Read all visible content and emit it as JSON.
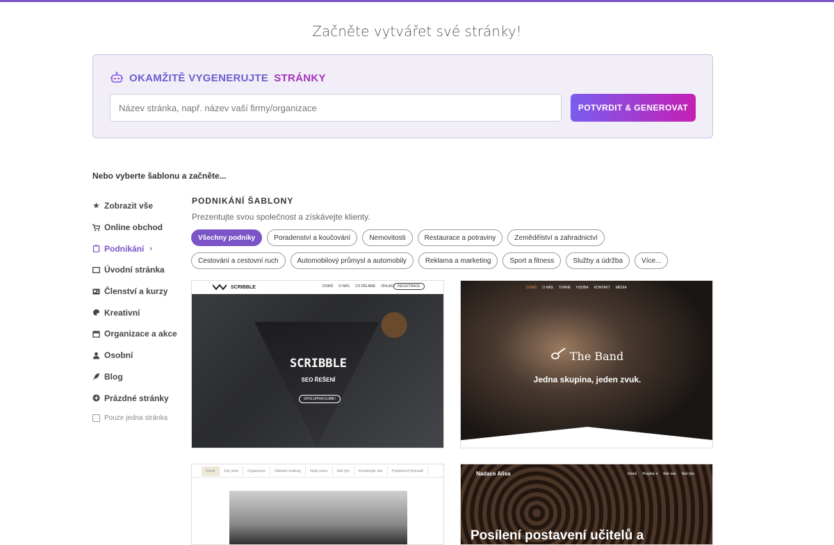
{
  "page": {
    "title": "Začněte vytvářet své stránky!"
  },
  "generator": {
    "icon": "robot-icon",
    "heading_part1": "OKAMŽITĚ VYGENERUJTE",
    "heading_part2": "STRÁNKY",
    "input_placeholder": "Název stránka, např. název vaší firmy/organizace",
    "input_value": "",
    "button_label": "POTVRDIT & GENEROVAT"
  },
  "or_choose": "Nebo vyberte šablonu a začněte...",
  "sidebar": {
    "items": [
      {
        "label": "Zobrazit vše",
        "icon": "star-icon"
      },
      {
        "label": "Online obchod",
        "icon": "cart-icon"
      },
      {
        "label": "Podnikání",
        "icon": "clipboard-icon",
        "active": true
      },
      {
        "label": "Úvodní stránka",
        "icon": "window-icon"
      },
      {
        "label": "Členství a kurzy",
        "icon": "id-card-icon"
      },
      {
        "label": "Kreativní",
        "icon": "palette-icon"
      },
      {
        "label": "Organizace a akce",
        "icon": "calendar-icon"
      },
      {
        "label": "Osobní",
        "icon": "user-icon"
      },
      {
        "label": "Blog",
        "icon": "feather-icon"
      },
      {
        "label": "Prázdné stránky",
        "icon": "plus-circle-icon"
      }
    ],
    "single_page_label": "Pouze jedna stránka"
  },
  "section": {
    "title": "PODNIKÁNÍ ŠABLONY",
    "subtitle": "Prezentujte svou společnost a získávejte klienty."
  },
  "filters": {
    "row1": [
      "Všechny podniky",
      "Poradenství a koučování",
      "Nemovitosti",
      "Restaurace a potraviny",
      "Zemědělství a zahradnictví"
    ],
    "row2": [
      "Cestování a cestovní ruch",
      "Automobilový průmysl a automobily",
      "Reklama a marketing",
      "Sport a fitness",
      "Služby a údržba",
      "Více..."
    ],
    "active": "Všechny podniky"
  },
  "templates": {
    "scribble": {
      "logo": "SCRIBBLE",
      "nav": [
        "DOMŮ",
        "O NÁS",
        "CO DĚLÁME",
        "OHLASY"
      ],
      "register": "REGISTRACE",
      "title": "SCRIBBLE",
      "subtitle": "SEO ŘEŠENÍ",
      "button": "SPOLUPRACUJME!"
    },
    "band": {
      "nav": [
        "DOMŮ",
        "O NÁS",
        "TURNÉ",
        "HUDBA",
        "KONTAKT",
        "MÉDIA"
      ],
      "brand": "The Band",
      "tagline": "Jedna skupina, jeden zvuk."
    },
    "third": {
      "nav": [
        "Domů",
        "Kdo jsme",
        "Organizace",
        "Základní hodnoty",
        "Naše práce",
        "Náš tým",
        "Kontaktujte nás",
        "Poptávkový formulář"
      ]
    },
    "alisa": {
      "brand": "Nadace Alisa",
      "nav": [
        "Domů",
        "Projekty ▾",
        "Kde nás",
        "Náš tým"
      ],
      "title": "Posílení postavení učitelů a"
    }
  }
}
